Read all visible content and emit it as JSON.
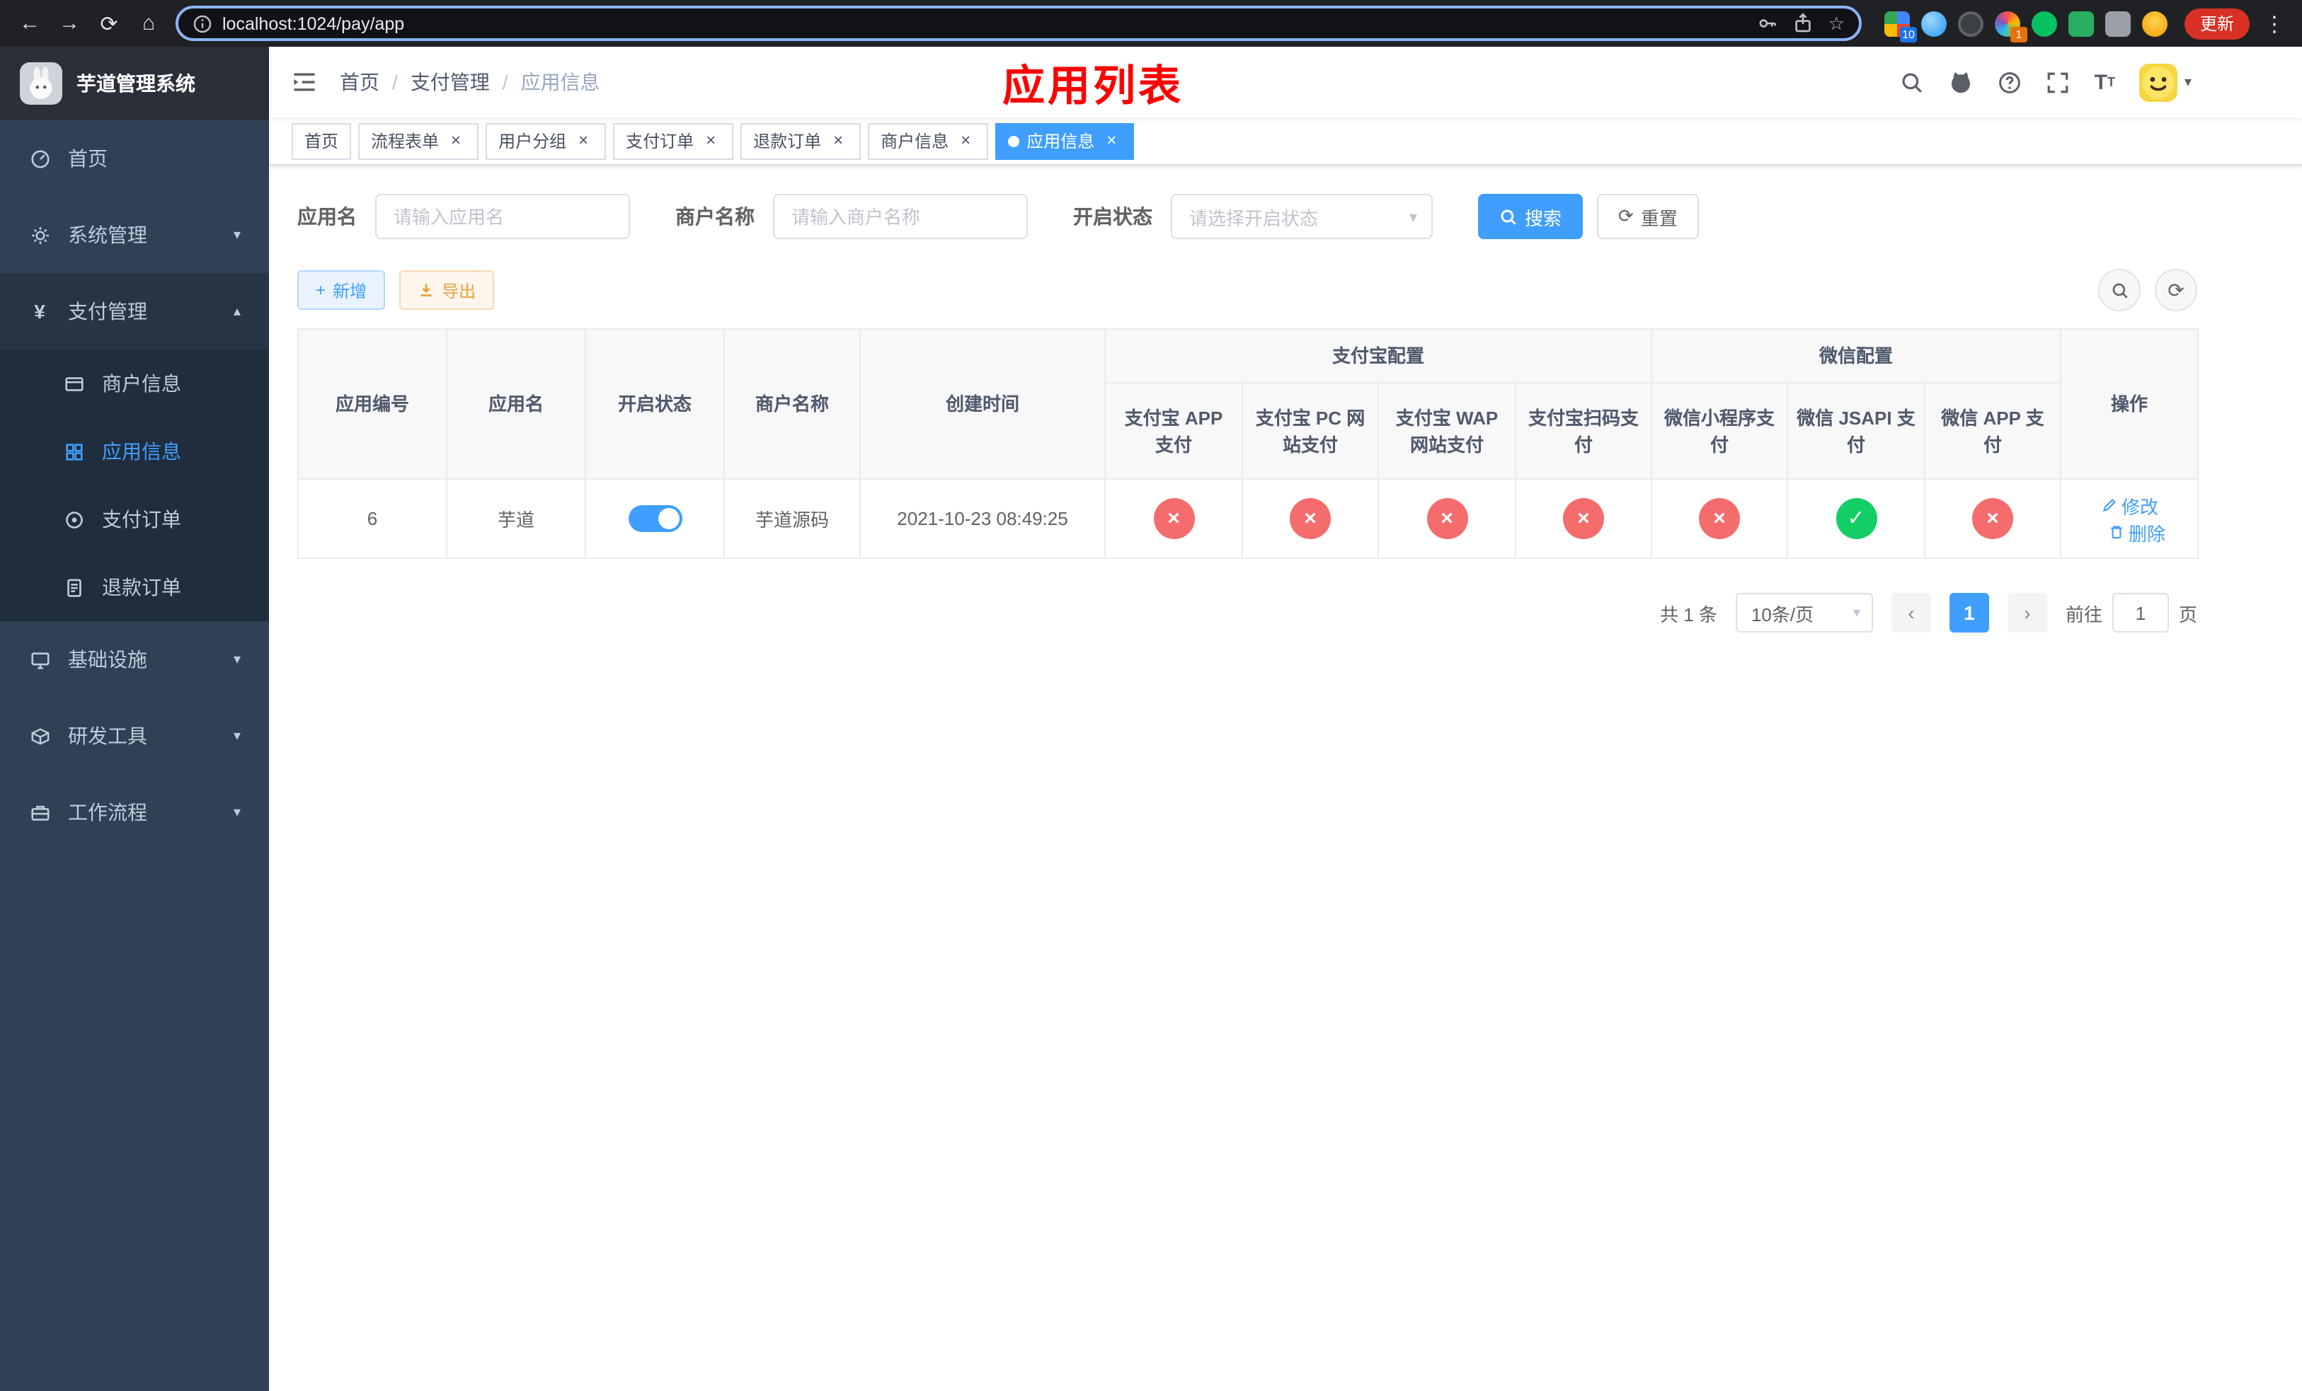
{
  "glyphs": {
    "back": "←",
    "forward": "→",
    "reload": "⟳",
    "home": "⌂",
    "star": "☆",
    "menu_dots": "⋮",
    "chevron_down": "▾",
    "chevron_up": "▴",
    "close": "×",
    "plus": "+",
    "refresh": "⟳",
    "prev": "‹",
    "next": "›",
    "caret": "▾",
    "yen": "¥",
    "slash": "/",
    "font_big": "T",
    "font_small": "T"
  },
  "colors": {
    "primary": "#409eff",
    "danger": "#f56c6c",
    "success": "#13ce66",
    "warning": "#e6a23c",
    "title_red": "#ff0000",
    "sidebar": "#304156"
  },
  "browser": {
    "url": "localhost:1024/pay/app",
    "update_label": "更新",
    "ext_badge_1": "10",
    "ext_badge_2": "1"
  },
  "sidebar": {
    "brand": "芋道管理系统",
    "home": "首页",
    "system": "系统管理",
    "payment": "支付管理",
    "merchant_info": "商户信息",
    "app_info": "应用信息",
    "pay_order": "支付订单",
    "refund_order": "退款订单",
    "infra": "基础设施",
    "dev_tools": "研发工具",
    "workflow": "工作流程"
  },
  "header": {
    "breadcrumb": [
      "首页",
      "支付管理",
      "应用信息"
    ],
    "title": "应用列表"
  },
  "tabs": [
    {
      "label": "首页"
    },
    {
      "label": "流程表单"
    },
    {
      "label": "用户分组"
    },
    {
      "label": "支付订单"
    },
    {
      "label": "退款订单"
    },
    {
      "label": "商户信息"
    },
    {
      "label": "应用信息"
    }
  ],
  "filters": {
    "app_name_label": "应用名",
    "app_name_placeholder": "请输入应用名",
    "merchant_label": "商户名称",
    "merchant_placeholder": "请输入商户名称",
    "status_label": "开启状态",
    "status_placeholder": "请选择开启状态",
    "search_label": "搜索",
    "reset_label": "重置"
  },
  "toolbar": {
    "add_label": "新增",
    "export_label": "导出"
  },
  "table": {
    "group_alipay": "支付宝配置",
    "group_wechat": "微信配置",
    "col_id": "应用编号",
    "col_name": "应用名",
    "col_status": "开启状态",
    "col_merchant": "商户名称",
    "col_created": "创建时间",
    "col_actions": "操作",
    "col_alipay_app": "支付宝 APP 支付",
    "col_alipay_pc": "支付宝 PC 网站支付",
    "col_alipay_wap": "支付宝 WAP 网站支付",
    "col_alipay_qr": "支付宝扫码支付",
    "col_wx_mini": "微信小程序支付",
    "col_wx_jsapi": "微信 JSAPI 支付",
    "col_wx_app": "微信 APP 支付",
    "row": {
      "id": "6",
      "name": "芋道",
      "status_on": true,
      "merchant": "芋道源码",
      "created": "2021-10-23 08:49:25",
      "configs": [
        {
          "name": "alipay-app-pay",
          "cls": "cfg off",
          "glyph": "×"
        },
        {
          "name": "alipay-pc-pay",
          "cls": "cfg off",
          "glyph": "×"
        },
        {
          "name": "alipay-wap-pay",
          "cls": "cfg off",
          "glyph": "×"
        },
        {
          "name": "alipay-qr-pay",
          "cls": "cfg off",
          "glyph": "×"
        },
        {
          "name": "wechat-mini-pay",
          "cls": "cfg off",
          "glyph": "×"
        },
        {
          "name": "wechat-jsapi-pay",
          "cls": "cfg on",
          "glyph": "✓"
        },
        {
          "name": "wechat-app-pay",
          "cls": "cfg off",
          "glyph": "×"
        }
      ],
      "edit_label": "修改",
      "delete_label": "删除"
    }
  },
  "pagination": {
    "total": "共 1 条",
    "page_size": "10条/页",
    "page": "1",
    "goto_label": "前往",
    "goto_value": "1",
    "unit": "页"
  }
}
